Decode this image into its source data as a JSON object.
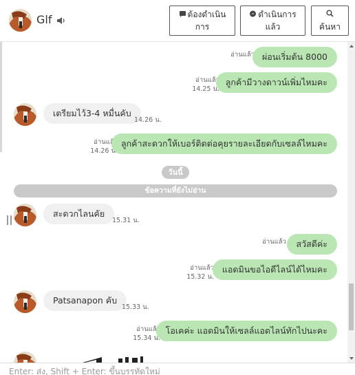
{
  "header": {
    "contact_name": "Glf",
    "btn_todo_line1": "ต้องดำเนิน",
    "btn_todo_line2": "การ",
    "btn_done_line1": "ดำเนินการ",
    "btn_done_line2": "แล้ว",
    "btn_search": "ค้นหา"
  },
  "messages": [
    {
      "dir": "out",
      "text": "ผ่อนเริ่มต้น 8000",
      "read": "อ่านแล้ว",
      "time": ""
    },
    {
      "dir": "out",
      "text": "ลูกค้ามีวางดาวน์เพิ่มไหมคะ",
      "read": "อ่านแล้ว",
      "time": "14.25 น."
    },
    {
      "dir": "in",
      "text": "เตรียมไว้3-4 หมื่นคับ",
      "time": "14.26 น."
    },
    {
      "dir": "out",
      "text": "ลูกค้าสะดวกให้เบอร์ติดต่อคุยรายละเอียดกับเซลล์ไหมคะ",
      "read": "อ่านแล้ว",
      "time": "14.26 น."
    },
    {
      "dir": "in",
      "text": "สะดวกไลนคัย",
      "time": "15.31 น."
    },
    {
      "dir": "out",
      "text": "สวัสดีค่ะ",
      "read": "อ่านแล้ว",
      "time": ""
    },
    {
      "dir": "out",
      "text": "แอดมินขอไอดีไลน์ได้ไหมคะ",
      "read": "อ่านแล้ว",
      "time": "15.32 น."
    },
    {
      "dir": "in",
      "text": "Patsanapon คับ",
      "time": "15.33 น."
    },
    {
      "dir": "out",
      "text": "โอเคค่ะ  แอดมินให้เซลล์แอดไลน์ทักไปนะคะ",
      "read": "อ่านแล้ว",
      "time": "15.34 น."
    }
  ],
  "day_separator": "วันนี้",
  "unread_divider": "ข้อความที่ยังไม่อ่าน",
  "input": {
    "placeholder": "Enter: ส่ง, Shift + Enter: ขึ้นบรรทัดใหม่"
  },
  "colors": {
    "outgoing_bubble": "#b9e6b3",
    "incoming_bubble": "#f0f0f0",
    "pill": "#c9c9c9"
  },
  "icons": [
    "speaker-icon",
    "chat-bubble-icon",
    "messenger-icon",
    "search-icon"
  ]
}
